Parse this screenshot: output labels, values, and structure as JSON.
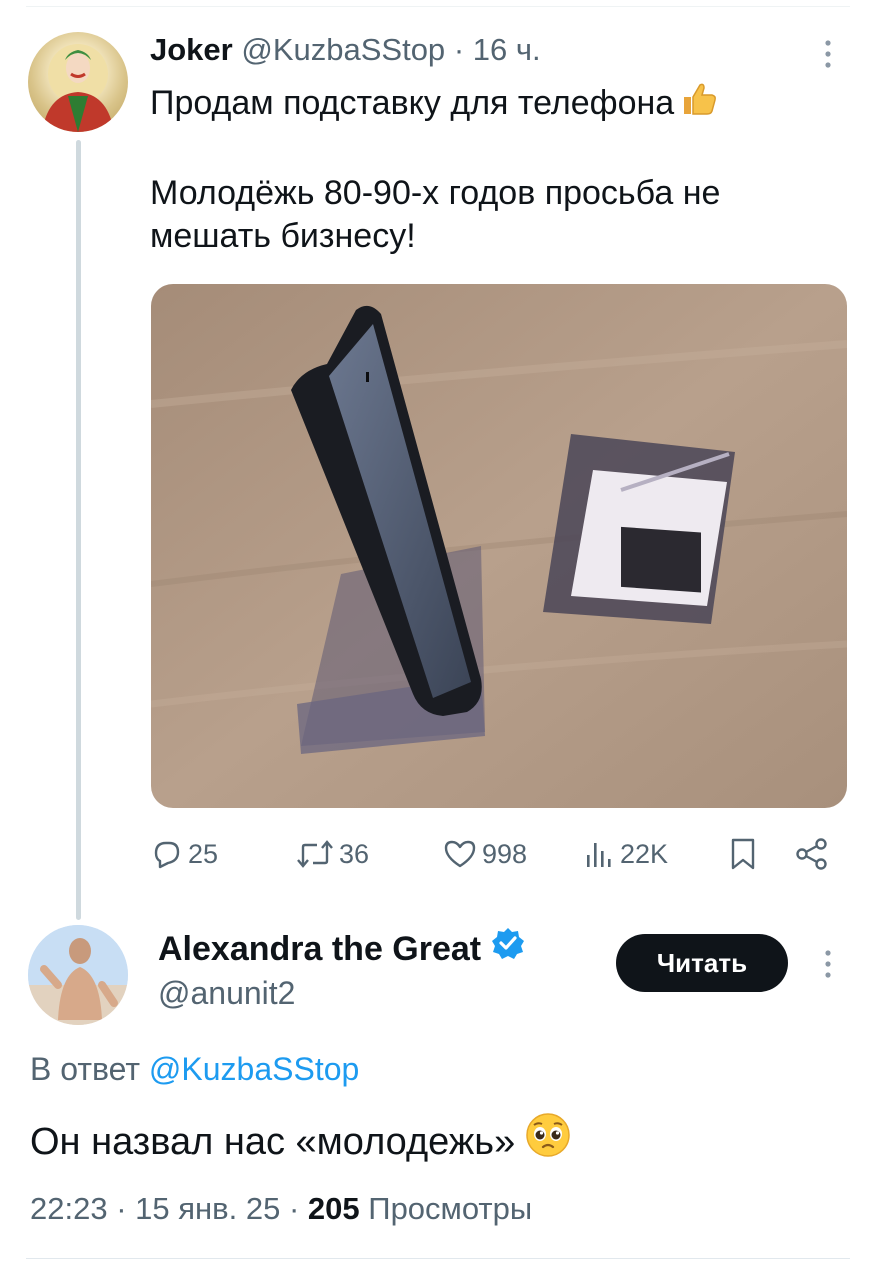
{
  "tweet": {
    "author_name": "Joker",
    "author_handle": "@KuzbaSStop",
    "separator": "·",
    "time": "16 ч.",
    "text_line1": "Продам подставку для телефона",
    "text_line2": "Молодёжь 80-90-х годов просьба не мешать бизнесу!",
    "emoji_icon": "thumbs-up-icon",
    "metrics": {
      "replies": "25",
      "reposts": "36",
      "likes": "998",
      "views": "22K"
    }
  },
  "reply": {
    "author_name": "Alexandra the Great",
    "author_handle": "@anunit2",
    "verified": true,
    "follow_label": "Читать",
    "reply_to_prefix": "В ответ",
    "reply_to_handle": "@KuzbaSStop",
    "text": "Он назвал нас «молодежь»",
    "emoji_icon": "pleading-face-icon",
    "time": "22:23",
    "separator": "·",
    "date": "15 янв. 25",
    "views_count": "205",
    "views_label": "Просмотры"
  },
  "colors": {
    "text": "#0f1419",
    "secondary": "#536471",
    "accent": "#1d9bf0",
    "follow_button": "#0f1419"
  }
}
